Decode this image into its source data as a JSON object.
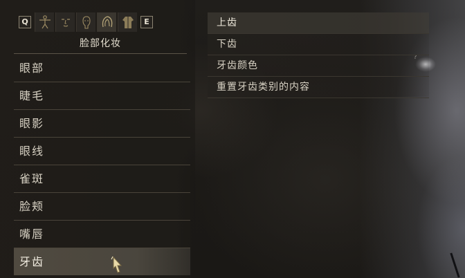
{
  "tabs": {
    "left_key": "Q",
    "right_key": "E",
    "icons": [
      "body-icon",
      "face-icon",
      "head-icon",
      "hair-icon",
      "outfit-icon"
    ],
    "active_index": 3
  },
  "category_panel": {
    "title": "脸部化妆",
    "items": [
      {
        "label": "眼部"
      },
      {
        "label": "睫毛"
      },
      {
        "label": "眼影"
      },
      {
        "label": "眼线"
      },
      {
        "label": "雀斑"
      },
      {
        "label": "脸颊"
      },
      {
        "label": "嘴唇"
      },
      {
        "label": "牙齿"
      }
    ],
    "selected_index": 7
  },
  "option_panel": {
    "items": [
      {
        "label": "上齿"
      },
      {
        "label": "下齿"
      },
      {
        "label": "牙齿颜色"
      },
      {
        "label": "重置牙齿类别的内容"
      }
    ],
    "selected_index": 0
  },
  "colors": {
    "accent_gold": "#9d8c63",
    "text_primary": "#d6d0c2",
    "selection_bg": "#6e6858"
  }
}
